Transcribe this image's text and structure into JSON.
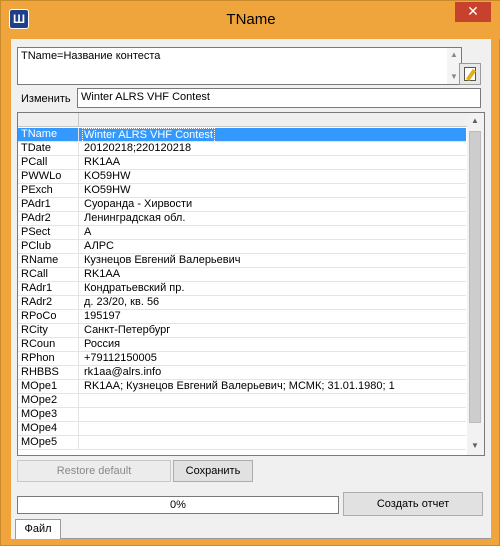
{
  "window": {
    "title": "TName"
  },
  "memo": {
    "text": "TName=Название контеста"
  },
  "change": {
    "label": "Изменить",
    "value": "Winter ALRS VHF Contest"
  },
  "grid": {
    "rows": [
      {
        "key": "TName",
        "value": "Winter ALRS VHF Contest",
        "selected": true
      },
      {
        "key": "TDate",
        "value": "20120218;220120218"
      },
      {
        "key": "PCall",
        "value": "RK1AA"
      },
      {
        "key": "PWWLo",
        "value": "KO59HW"
      },
      {
        "key": "PExch",
        "value": "KO59HW"
      },
      {
        "key": "PAdr1",
        "value": "Суоранда - Хирвости"
      },
      {
        "key": "PAdr2",
        "value": "Ленинградская обл."
      },
      {
        "key": "PSect",
        "value": "A"
      },
      {
        "key": "PClub",
        "value": "АЛРС"
      },
      {
        "key": "RName",
        "value": "Кузнецов Евгений Валерьевич"
      },
      {
        "key": "RCall",
        "value": "RK1AA"
      },
      {
        "key": "RAdr1",
        "value": "Кондратьевский пр."
      },
      {
        "key": "RAdr2",
        "value": "д. 23/20, кв. 56"
      },
      {
        "key": "RPoCo",
        "value": "195197"
      },
      {
        "key": "RCity",
        "value": "Санкт-Петербург"
      },
      {
        "key": "RCoun",
        "value": "Россия"
      },
      {
        "key": "RPhon",
        "value": "+79112150005"
      },
      {
        "key": "RHBBS",
        "value": "rk1aa@alrs.info"
      },
      {
        "key": "MOpe1",
        "value": "RK1AA; Кузнецов Евгений Валерьевич; МСМК; 31.01.1980; 1"
      },
      {
        "key": "MOpe2",
        "value": ""
      },
      {
        "key": "MOpe3",
        "value": ""
      },
      {
        "key": "MOpe4",
        "value": ""
      },
      {
        "key": "MOpe5",
        "value": ""
      }
    ]
  },
  "buttons": {
    "restore": "Restore default",
    "save": "Сохранить",
    "report": "Создать отчет"
  },
  "progress": {
    "label": "0%",
    "value": 0
  },
  "tabs": {
    "file": "Файл"
  },
  "colors": {
    "titlebar": "#f0a43c",
    "selection": "#3399ff",
    "close": "#c7422d"
  }
}
